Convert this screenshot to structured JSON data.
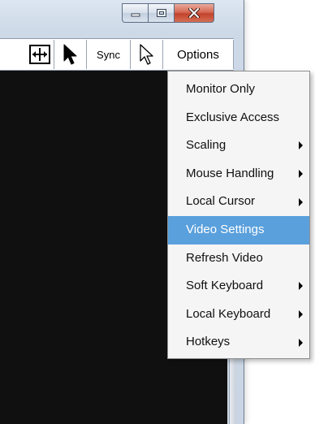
{
  "window": {
    "caption_buttons": [
      "minimize",
      "maximize",
      "close"
    ]
  },
  "toolbar": {
    "fit_icon": "fit-to-window-icon",
    "cursor_icon": "cursor-icon",
    "sync_label": "Sync",
    "pointer_icon": "pointer-icon",
    "options_label": "Options"
  },
  "menu": {
    "items": [
      {
        "label": "Monitor Only",
        "has_submenu": false,
        "selected": false
      },
      {
        "label": "Exclusive Access",
        "has_submenu": false,
        "selected": false
      },
      {
        "label": "Scaling",
        "has_submenu": true,
        "selected": false
      },
      {
        "label": "Mouse Handling",
        "has_submenu": true,
        "selected": false
      },
      {
        "label": "Local Cursor",
        "has_submenu": true,
        "selected": false
      },
      {
        "label": "Video Settings",
        "has_submenu": false,
        "selected": true
      },
      {
        "label": "Refresh Video",
        "has_submenu": false,
        "selected": false
      },
      {
        "label": "Soft Keyboard",
        "has_submenu": true,
        "selected": false
      },
      {
        "label": "Local Keyboard",
        "has_submenu": true,
        "selected": false
      },
      {
        "label": "Hotkeys",
        "has_submenu": true,
        "selected": false
      }
    ]
  },
  "colors": {
    "selection": "#5aa0dc",
    "viewer_background": "#101010",
    "menu_background": "#f5f5f5"
  }
}
